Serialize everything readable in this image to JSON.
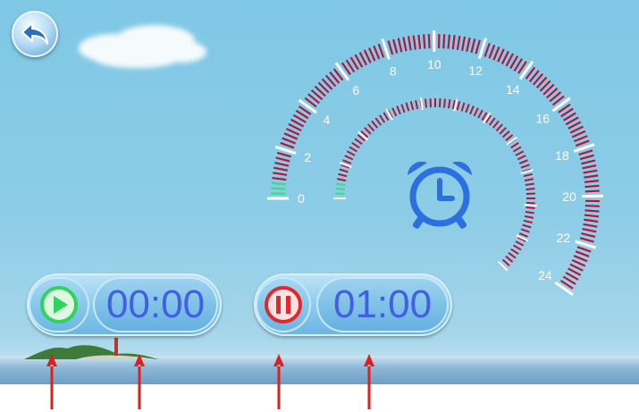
{
  "gauge": {
    "outer_scale_labels": [
      "0",
      "2",
      "4",
      "6",
      "8",
      "10",
      "12",
      "14",
      "16",
      "18",
      "20",
      "22",
      "24"
    ],
    "fill_color": "#b3163a",
    "tick_color": "#ffffff",
    "active_color": "#3ddc84",
    "label_color": "#ffffff"
  },
  "icons": {
    "back": "back-arrow-icon",
    "clock": "alarm-clock-icon",
    "play": "play-icon",
    "pause": "pause-icon"
  },
  "left_control": {
    "time": "00:00",
    "icon_color": "#2fd45a"
  },
  "right_control": {
    "time": "01:00",
    "icon_color": "#e0282e"
  },
  "colors": {
    "time_text": "#3f5fe6",
    "annotation_arrow": "#e01e1e",
    "clock_icon": "#2b6fe0"
  }
}
